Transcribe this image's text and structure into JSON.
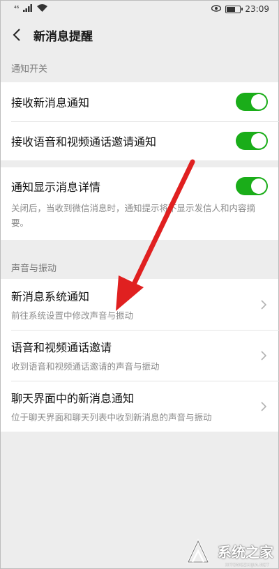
{
  "status_bar": {
    "signal_label": "⁴⁶",
    "time": "23:09"
  },
  "header": {
    "title": "新消息提醒"
  },
  "sections": {
    "notification_switch": {
      "header": "通知开关",
      "receive_new": {
        "label": "接收新消息通知",
        "on": true
      },
      "receive_av": {
        "label": "接收语音和视频通话邀请通知",
        "on": true
      },
      "show_details": {
        "label": "通知显示消息详情",
        "on": true,
        "description": "关闭后，当收到微信消息时，通知提示将不显示发信人和内容摘要。"
      }
    },
    "sound_vibration": {
      "header": "声音与振动",
      "items": [
        {
          "title": "新消息系统通知",
          "subtitle": "前往系统设置中修改声音与振动"
        },
        {
          "title": "语音和视频通话邀请",
          "subtitle": "收到语音和视频通话邀请的声音与振动"
        },
        {
          "title": "聊天界面中的新消息通知",
          "subtitle": "位于聊天界面和聊天列表中收到新消息的声音与振动"
        }
      ]
    }
  },
  "colors": {
    "toggle_on": "#1aad19",
    "arrow": "#e02020",
    "background": "#ededed"
  },
  "icons": {
    "back": "chevron-left-icon",
    "row_nav": "chevron-right-icon"
  },
  "watermark": {
    "text": "系统之家",
    "sub": "XITONGZHIJIA.NET"
  }
}
